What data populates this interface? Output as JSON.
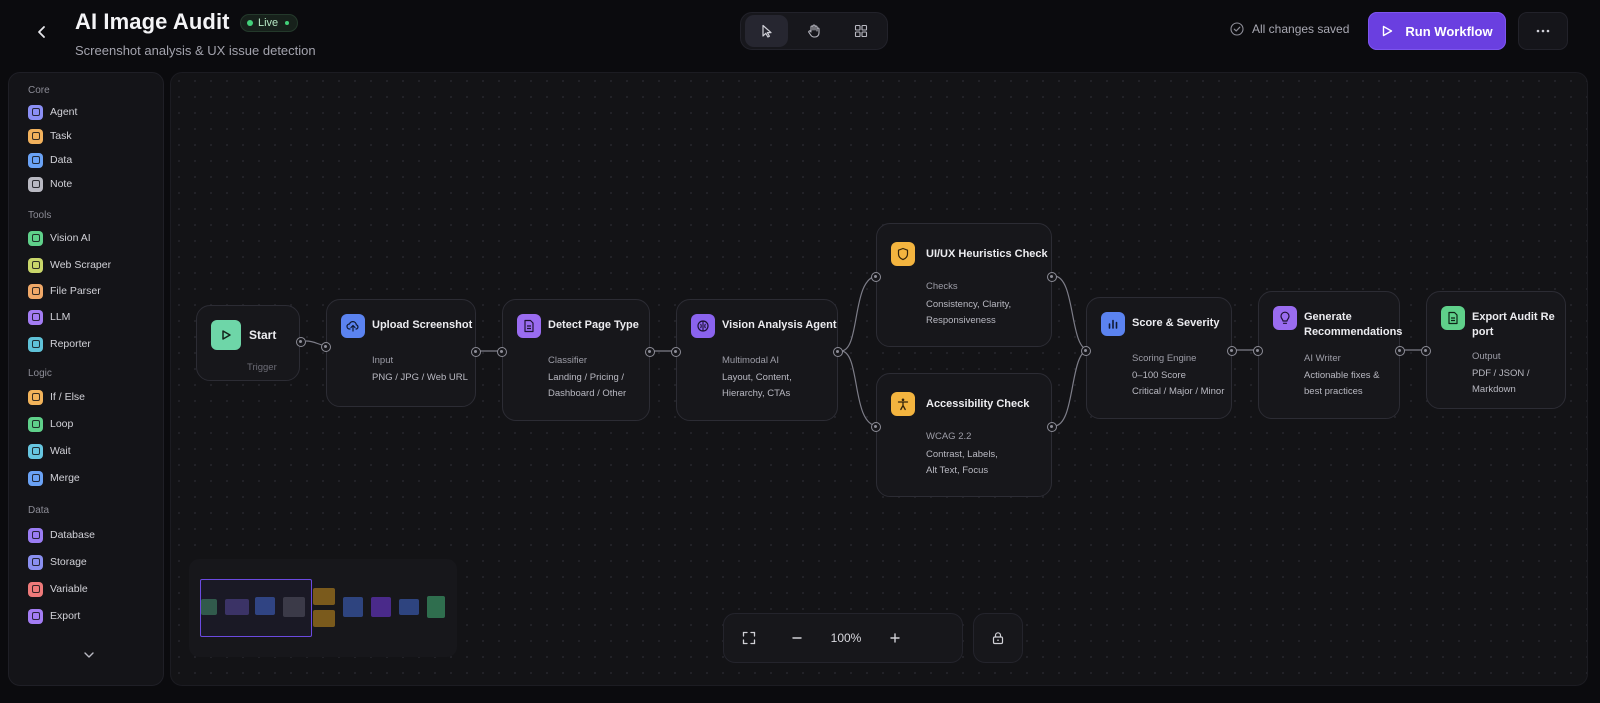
{
  "header": {
    "title": "AI Image Audit",
    "badge": "Live",
    "subtitle": "Screenshot analysis & UX issue detection",
    "saved_status": "All changes saved",
    "run_label": "Run Workflow",
    "accent": "#6a3fe0"
  },
  "toolbar": {
    "tools": [
      {
        "name": "select-tool",
        "icon": "cursor-icon",
        "active": true
      },
      {
        "name": "pan-tool",
        "icon": "hand-icon",
        "active": false
      },
      {
        "name": "frame-tool",
        "icon": "frame-icon",
        "active": false
      }
    ]
  },
  "sidebar": {
    "groups": [
      {
        "heading": "Core",
        "items": [
          {
            "label": "Agent",
            "color": "#8b8ff5"
          },
          {
            "label": "Task",
            "color": "#f2b15c"
          },
          {
            "label": "Data",
            "color": "#6aa2f5"
          },
          {
            "label": "Note",
            "color": "#b9b9c2"
          }
        ]
      },
      {
        "heading": "Tools",
        "items": [
          {
            "label": "Vision AI",
            "color": "#5fd08a"
          },
          {
            "label": "Web Scraper",
            "color": "#c9d66a"
          },
          {
            "label": "File Parser",
            "color": "#f0a868"
          },
          {
            "label": "LLM",
            "color": "#a37cf3"
          },
          {
            "label": "Reporter",
            "color": "#5fc2d8"
          }
        ]
      },
      {
        "heading": "Logic",
        "items": [
          {
            "label": "If / Else",
            "color": "#f2b35a"
          },
          {
            "label": "Loop",
            "color": "#5fd08a"
          },
          {
            "label": "Wait",
            "color": "#67c6e0"
          },
          {
            "label": "Merge",
            "color": "#6aa2f5"
          }
        ]
      },
      {
        "heading": "Data",
        "items": [
          {
            "label": "Database",
            "color": "#9a7cf3"
          },
          {
            "label": "Storage",
            "color": "#8a8ff0"
          },
          {
            "label": "Variable",
            "color": "#ee7a7a"
          },
          {
            "label": "Export",
            "color": "#a37cf3"
          }
        ]
      }
    ]
  },
  "nodes": [
    {
      "id": "start",
      "title": "Start",
      "label": "Trigger",
      "desc": [],
      "color": "#6ed6a8",
      "icon": "play-icon"
    },
    {
      "id": "upload",
      "title": "Upload Screenshot",
      "label": "Input",
      "desc": [
        "PNG / JPG / Web URL"
      ],
      "color": "#5b83f0",
      "icon": "upload-cloud-icon"
    },
    {
      "id": "detect",
      "title": "Detect Page Type",
      "label": "Classifier",
      "desc": [
        "Landing / Pricing /",
        "Dashboard / Other"
      ],
      "color": "#9a6cf0",
      "icon": "document-icon"
    },
    {
      "id": "vision",
      "title": "Vision Analysis Agent",
      "label": "Multimodal AI",
      "desc": [
        "Layout, Content,",
        "Hierarchy, CTAs"
      ],
      "color": "#8a63ee",
      "icon": "brain-icon"
    },
    {
      "id": "heuristics",
      "title": "UI/UX Heuristics Check",
      "label": "Checks",
      "desc": [
        "Consistency, Clarity,",
        "Responsiveness"
      ],
      "color": "#f3b43f",
      "icon": "shield-icon"
    },
    {
      "id": "a11y",
      "title": "Accessibility Check",
      "label": "WCAG 2.2",
      "desc": [
        "Contrast, Labels,",
        "Alt Text, Focus"
      ],
      "color": "#f3b43f",
      "icon": "accessibility-icon"
    },
    {
      "id": "score",
      "title": "Score & Severity",
      "label": "Scoring Engine",
      "desc": [
        "0–100 Score",
        "Critical / Major / Minor"
      ],
      "color": "#5b83f0",
      "icon": "bar-chart-icon"
    },
    {
      "id": "recs",
      "title": "Generate Recommendations",
      "label": "AI Writer",
      "desc": [
        "Actionable fixes &",
        "best practices"
      ],
      "color": "#9a6cf0",
      "icon": "lightbulb-icon"
    },
    {
      "id": "export",
      "title": "Export Audit Report",
      "label": "Output",
      "desc": [
        "PDF / JSON /",
        "Markdown"
      ],
      "color": "#5fd08a",
      "icon": "file-icon"
    }
  ],
  "zoom": {
    "value": "100%"
  }
}
